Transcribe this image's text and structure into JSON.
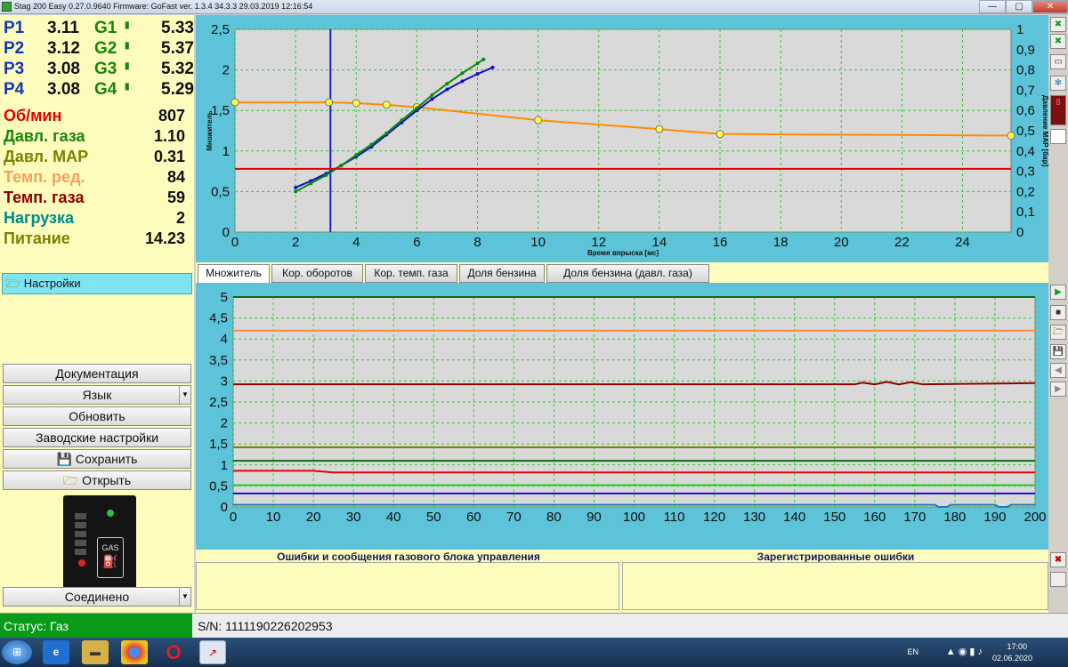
{
  "window": {
    "title": "Stag 200 Easy 0.27.0.9640 Firmware: GoFast  ver. 1.3.4  34.3.3   29.03.2019 12:16:54",
    "minimize": "—",
    "maximize": "▢",
    "close": "✕"
  },
  "readings": {
    "injectors": [
      {
        "p": "P1",
        "pv": "3.11",
        "g": "G1",
        "gv": "5.33"
      },
      {
        "p": "P2",
        "pv": "3.12",
        "g": "G2",
        "gv": "5.37"
      },
      {
        "p": "P3",
        "pv": "3.08",
        "g": "G3",
        "gv": "5.32"
      },
      {
        "p": "P4",
        "pv": "3.08",
        "g": "G4",
        "gv": "5.29"
      }
    ],
    "sensors": [
      {
        "label": "Об/мин",
        "value": "807",
        "color": "#e00000"
      },
      {
        "label": "Давл. газа",
        "value": "1.10",
        "color": "#17860e"
      },
      {
        "label": "Давл. MAP",
        "value": "0.31",
        "color": "#808000"
      },
      {
        "label": "Темп. ред.",
        "value": "84",
        "color": "#f5a060"
      },
      {
        "label": "Темп. газа",
        "value": "59",
        "color": "#8b0000"
      },
      {
        "label": "Нагрузка",
        "value": "2",
        "color": "#008b8b"
      },
      {
        "label": "Питание",
        "value": "14.23",
        "color": "#808000"
      }
    ]
  },
  "menu": {
    "header": "Настройки",
    "buttons": {
      "docs": "Документация",
      "language": "Язык",
      "refresh": "Обновить",
      "factory": "Заводские настройки",
      "save": "Сохранить",
      "open": "Открыть",
      "connection": "Соединено"
    }
  },
  "ecu": {
    "label": "GAS"
  },
  "tabs": [
    "Множитель",
    "Кор. оборотов",
    "Кор. темп. газа",
    "Доля бензина",
    "Доля бензина (давл. газа)"
  ],
  "errors": {
    "left_title": "Ошибки и сообщения газового блока управления",
    "right_title": "Зарегистрированные ошибки"
  },
  "status": {
    "state": "Статус: Газ",
    "serial": "S/N: 1111190226202953"
  },
  "tray": {
    "lang": "EN",
    "time": "17:00",
    "date": "02.06.2020"
  },
  "colors": {
    "panel": "#5cc3d8",
    "plot_bg": "#d9d9d9",
    "grid": "#3cc43c"
  },
  "chart_data": [
    {
      "type": "line",
      "title": "",
      "xlabel": "Время впрыска [мс]",
      "ylabel": "Множитель",
      "y2label": "Давление MAP [бар]",
      "xlim": [
        0,
        25.6
      ],
      "ylim": [
        0,
        2.5
      ],
      "y2lim": [
        0,
        1
      ],
      "x_ticks": [
        0,
        2,
        4,
        6,
        8,
        10,
        12,
        14,
        16,
        18,
        20,
        22,
        24
      ],
      "y_ticks": [
        "0",
        "0,5",
        "1",
        "1,5",
        "2",
        "2,5"
      ],
      "y2_ticks": [
        "0",
        "0,1",
        "0,2",
        "0,3",
        "0,4",
        "0,5",
        "0,6",
        "0,7",
        "0,8",
        "0,9",
        "1"
      ],
      "grid": true,
      "cursor_x": 3.15,
      "series": [
        {
          "color": "#ff8c00",
          "axis": "left",
          "marker": "yellow-circle",
          "x": [
            0,
            3.1,
            4,
            5,
            6,
            10,
            14,
            16,
            25.6
          ],
          "y": [
            1.6,
            1.6,
            1.59,
            1.57,
            1.54,
            1.38,
            1.27,
            1.21,
            1.19
          ]
        },
        {
          "color": "#1010c0",
          "axis": "left",
          "x": [
            2,
            2.5,
            3,
            3.5,
            4,
            4.5,
            5,
            5.5,
            6,
            6.5,
            7,
            7.5,
            8,
            8.5
          ],
          "y": [
            0.55,
            0.63,
            0.72,
            0.82,
            0.93,
            1.05,
            1.2,
            1.35,
            1.5,
            1.64,
            1.76,
            1.86,
            1.95,
            2.03
          ]
        },
        {
          "color": "#0a8a0a",
          "axis": "left",
          "x": [
            2,
            2.5,
            3,
            3.5,
            4,
            4.5,
            5,
            5.5,
            6,
            6.5,
            7,
            7.5,
            8,
            8.2
          ],
          "y": [
            0.5,
            0.6,
            0.7,
            0.82,
            0.95,
            1.08,
            1.22,
            1.38,
            1.53,
            1.69,
            1.83,
            1.96,
            2.08,
            2.13
          ]
        },
        {
          "color": "#e00000",
          "axis": "left",
          "x": [
            0,
            25.6
          ],
          "y": [
            0.78,
            0.78
          ]
        }
      ]
    },
    {
      "type": "line",
      "title": "",
      "xlim": [
        0,
        200
      ],
      "ylim": [
        0,
        5
      ],
      "x_ticks": [
        0,
        10,
        20,
        30,
        40,
        50,
        60,
        70,
        80,
        90,
        100,
        110,
        120,
        130,
        140,
        150,
        160,
        170,
        180,
        190,
        200
      ],
      "y_ticks": [
        "0",
        "0,5",
        "1",
        "1,5",
        "2",
        "2,5",
        "3",
        "3,5",
        "4",
        "4,5",
        "5"
      ],
      "grid": true,
      "series": [
        {
          "color": "#0a6e0a",
          "x": [
            0,
            200
          ],
          "y": [
            5.0,
            5.0
          ]
        },
        {
          "color": "#ff8c40",
          "x": [
            0,
            200
          ],
          "y": [
            4.2,
            4.2
          ]
        },
        {
          "color": "#8b0000",
          "x": [
            0,
            155,
            157,
            160,
            163,
            166,
            169,
            172,
            200
          ],
          "y": [
            2.92,
            2.92,
            2.96,
            2.92,
            2.98,
            2.92,
            2.97,
            2.92,
            2.95
          ]
        },
        {
          "color": "#808000",
          "x": [
            0,
            200
          ],
          "y": [
            1.42,
            1.42
          ]
        },
        {
          "color": "#0a6e0a",
          "x": [
            0,
            200
          ],
          "y": [
            1.1,
            1.1
          ]
        },
        {
          "color": "#e00000",
          "x": [
            0,
            20,
            25,
            200
          ],
          "y": [
            0.86,
            0.86,
            0.82,
            0.82
          ]
        },
        {
          "color": "#22cc22",
          "x": [
            0,
            200
          ],
          "y": [
            0.52,
            0.52
          ]
        },
        {
          "color": "#1010c0",
          "x": [
            0,
            200
          ],
          "y": [
            0.32,
            0.32
          ]
        },
        {
          "color": "#1a7fbf",
          "x": [
            0,
            175,
            176,
            178,
            179,
            190,
            191,
            193,
            194,
            200
          ],
          "y": [
            0.05,
            0.05,
            0.0,
            0.0,
            0.05,
            0.05,
            0.0,
            0.0,
            0.05,
            0.05
          ]
        }
      ]
    }
  ]
}
